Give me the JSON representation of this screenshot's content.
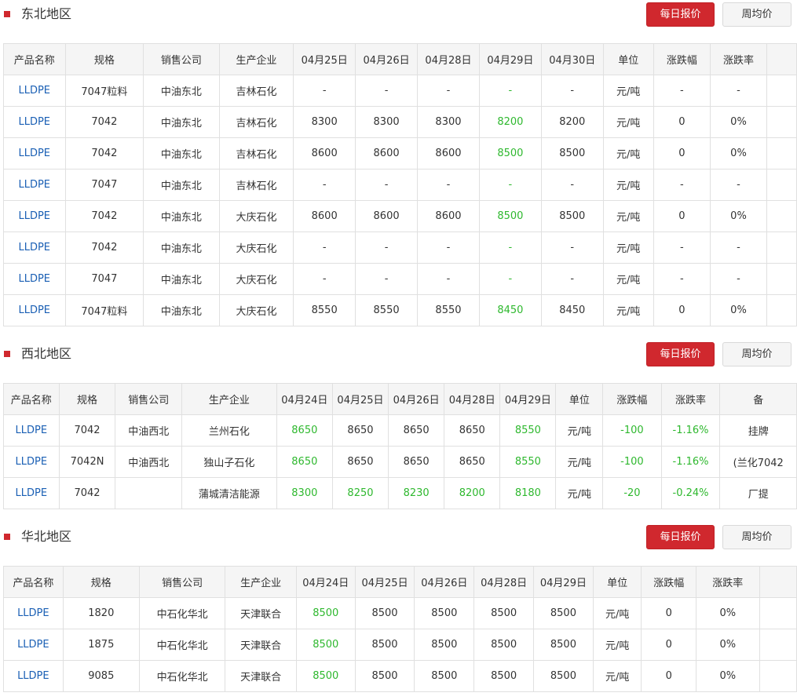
{
  "colors": {
    "accent": "#d0282e",
    "link": "#1a5fb4",
    "down": "#2eb82e"
  },
  "sections": [
    {
      "title": "东北地区",
      "daily_label": "每日报价",
      "weekly_label": "周均价",
      "headers": [
        "产品名称",
        "规格",
        "销售公司",
        "生产企业",
        "04月25日",
        "04月26日",
        "04月28日",
        "04月29日",
        "04月30日",
        "单位",
        "涨跌幅",
        "涨跌率",
        ""
      ],
      "rows": [
        [
          "LLDPE",
          "7047粒料",
          "中油东北",
          "吉林石化",
          "-",
          "-",
          "-",
          "-",
          "-",
          "元/吨",
          "-",
          "-",
          ""
        ],
        [
          "LLDPE",
          "7042",
          "中油东北",
          "吉林石化",
          "8300",
          "8300",
          "8300",
          "8200",
          "8200",
          "元/吨",
          "0",
          "0%",
          ""
        ],
        [
          "LLDPE",
          "7042",
          "中油东北",
          "吉林石化",
          "8600",
          "8600",
          "8600",
          "8500",
          "8500",
          "元/吨",
          "0",
          "0%",
          ""
        ],
        [
          "LLDPE",
          "7047",
          "中油东北",
          "吉林石化",
          "-",
          "-",
          "-",
          "-",
          "-",
          "元/吨",
          "-",
          "-",
          ""
        ],
        [
          "LLDPE",
          "7042",
          "中油东北",
          "大庆石化",
          "8600",
          "8600",
          "8600",
          "8500",
          "8500",
          "元/吨",
          "0",
          "0%",
          ""
        ],
        [
          "LLDPE",
          "7042",
          "中油东北",
          "大庆石化",
          "-",
          "-",
          "-",
          "-",
          "-",
          "元/吨",
          "-",
          "-",
          ""
        ],
        [
          "LLDPE",
          "7047",
          "中油东北",
          "大庆石化",
          "-",
          "-",
          "-",
          "-",
          "-",
          "元/吨",
          "-",
          "-",
          ""
        ],
        [
          "LLDPE",
          "7047粒料",
          "中油东北",
          "大庆石化",
          "8550",
          "8550",
          "8550",
          "8450",
          "8450",
          "元/吨",
          "0",
          "0%",
          ""
        ]
      ],
      "green_cols": [
        7
      ]
    },
    {
      "title": "西北地区",
      "daily_label": "每日报价",
      "weekly_label": "周均价",
      "headers": [
        "产品名称",
        "规格",
        "销售公司",
        "生产企业",
        "04月24日",
        "04月25日",
        "04月26日",
        "04月28日",
        "04月29日",
        "单位",
        "涨跌幅",
        "涨跌率",
        "备"
      ],
      "rows": [
        [
          "LLDPE",
          "7042",
          "中油西北",
          "兰州石化",
          "8650",
          "8650",
          "8650",
          "8650",
          "8550",
          "元/吨",
          "-100",
          "-1.16%",
          "挂牌"
        ],
        [
          "LLDPE",
          "7042N",
          "中油西北",
          "独山子石化",
          "8650",
          "8650",
          "8650",
          "8650",
          "8550",
          "元/吨",
          "-100",
          "-1.16%",
          "(兰化7042"
        ],
        [
          "LLDPE",
          "7042",
          "",
          "蒲城清洁能源",
          "8300",
          "8250",
          "8230",
          "8200",
          "8180",
          "元/吨",
          "-20",
          "-0.24%",
          "厂提"
        ]
      ],
      "green_cols_by_row": [
        [
          4,
          8,
          10,
          11
        ],
        [
          4,
          8,
          10,
          11
        ],
        [
          4,
          5,
          6,
          7,
          8,
          10,
          11
        ]
      ]
    },
    {
      "title": "华北地区",
      "daily_label": "每日报价",
      "weekly_label": "周均价",
      "headers": [
        "产品名称",
        "规格",
        "销售公司",
        "生产企业",
        "04月24日",
        "04月25日",
        "04月26日",
        "04月28日",
        "04月29日",
        "单位",
        "涨跌幅",
        "涨跌率",
        ""
      ],
      "rows": [
        [
          "LLDPE",
          "1820",
          "中石化华北",
          "天津联合",
          "8500",
          "8500",
          "8500",
          "8500",
          "8500",
          "元/吨",
          "0",
          "0%",
          ""
        ],
        [
          "LLDPE",
          "1875",
          "中石化华北",
          "天津联合",
          "8500",
          "8500",
          "8500",
          "8500",
          "8500",
          "元/吨",
          "0",
          "0%",
          ""
        ],
        [
          "LLDPE",
          "9085",
          "中石化华北",
          "天津联合",
          "8500",
          "8500",
          "8500",
          "8500",
          "8500",
          "元/吨",
          "0",
          "0%",
          ""
        ]
      ],
      "green_cols": [
        4
      ]
    }
  ]
}
